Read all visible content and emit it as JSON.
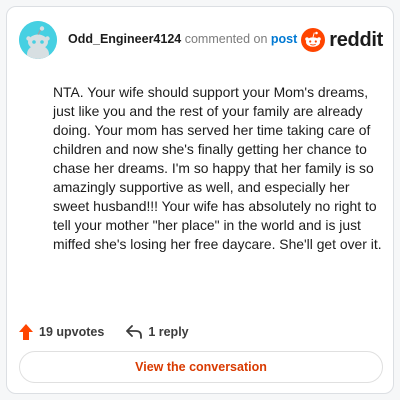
{
  "header": {
    "username": "Odd_Engineer4124",
    "commented_on": "commented on",
    "post_link": "post",
    "brand_wordmark": "reddit",
    "logo_icon": "reddit-snoo-icon",
    "avatar_icon": "default-snoo-avatar"
  },
  "comment": {
    "body": "NTA. Your wife should support your Mom's dreams, just like you and the rest of your family are already doing. Your mom has served her time taking care of children and now she's finally getting her chance to chase her dreams. I'm so happy that her family is so amazingly supportive as well, and especially her sweet husband!!! Your wife has absolutely no right to tell your mother \"her place\" in the world and is just miffed she's losing her free daycare. She'll get over it."
  },
  "actions": {
    "upvotes": "19 upvotes",
    "replies": "1 reply",
    "upvote_icon": "upvote-arrow-icon",
    "reply_icon": "reply-arrow-icon"
  },
  "footer": {
    "view_button": "View the conversation"
  },
  "colors": {
    "accent": "#ff4500",
    "link": "#0079d3",
    "button_text": "#d93a00",
    "avatar_bg": "#46d0e2"
  }
}
